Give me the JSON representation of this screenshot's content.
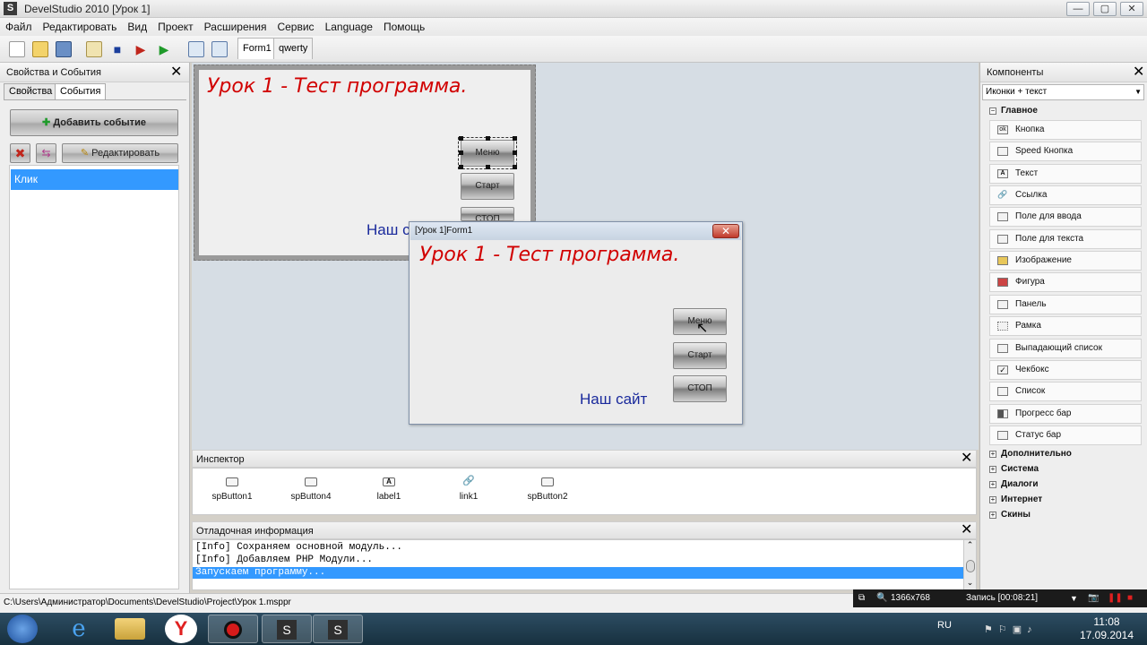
{
  "window": {
    "title": "DevelStudio 2010 [Урок 1]",
    "minimize": "—",
    "maximize": "▢",
    "close": "✕"
  },
  "menu": [
    "Файл",
    "Редактировать",
    "Вид",
    "Проект",
    "Расширения",
    "Сервис",
    "Language",
    "Помощь"
  ],
  "doc_tabs": [
    "Form1",
    "qwerty"
  ],
  "left_panel": {
    "title": "Свойства и События",
    "tabs": [
      "Свойства",
      "События"
    ],
    "add_event": "Добавить событие",
    "edit": "Редактировать",
    "events": [
      "Клик"
    ]
  },
  "design_form": {
    "title_label": "Урок 1 - Тест программа.",
    "site_label": "Наш с",
    "buttons": [
      "Меню",
      "Старт",
      "СТОП"
    ]
  },
  "running_form": {
    "title": "[Урок 1]Form1",
    "title_label": "Урок 1 - Тест программа.",
    "site_label": "Наш сайт",
    "buttons": [
      "Меню",
      "Старт",
      "СТОП"
    ]
  },
  "inspector": {
    "title": "Инспектор",
    "items": [
      "spButton1",
      "spButton4",
      "label1",
      "link1",
      "spButton2"
    ]
  },
  "debug": {
    "title": "Отладочная информация",
    "lines": [
      "[Info] Сохраняем основной модуль...",
      "[Info] Добавляем PHP Модули...",
      "Запускаем программу..."
    ]
  },
  "components": {
    "title": "Компоненты",
    "view_mode": "Иконки + текст",
    "main_group": "Главное",
    "items": [
      "Кнопка",
      "Speed Кнопка",
      "Текст",
      "Ссылка",
      "Поле для ввода",
      "Поле для текста",
      "Изображение",
      "Фигура",
      "Панель",
      "Рамка",
      "Выпадающий список",
      "Чекбокс",
      "Список",
      "Прогресс бар",
      "Статус бар"
    ],
    "groups": [
      "Дополнительно",
      "Система",
      "Диалоги",
      "Интернет",
      "Скины"
    ]
  },
  "statusbar": {
    "path": "C:\\Users\\Администратор\\Documents\\DevelStudio\\Project\\Урок 1.msppr"
  },
  "recorder": {
    "resolution": "1366x768",
    "record": "Запись [00:08:21]"
  },
  "tray": {
    "lang": "RU",
    "time": "11:08",
    "date": "17.09.2014"
  },
  "colors": {
    "selection": "#3399ff",
    "red_title": "#d10000",
    "navy_label": "#1a2a9c"
  }
}
